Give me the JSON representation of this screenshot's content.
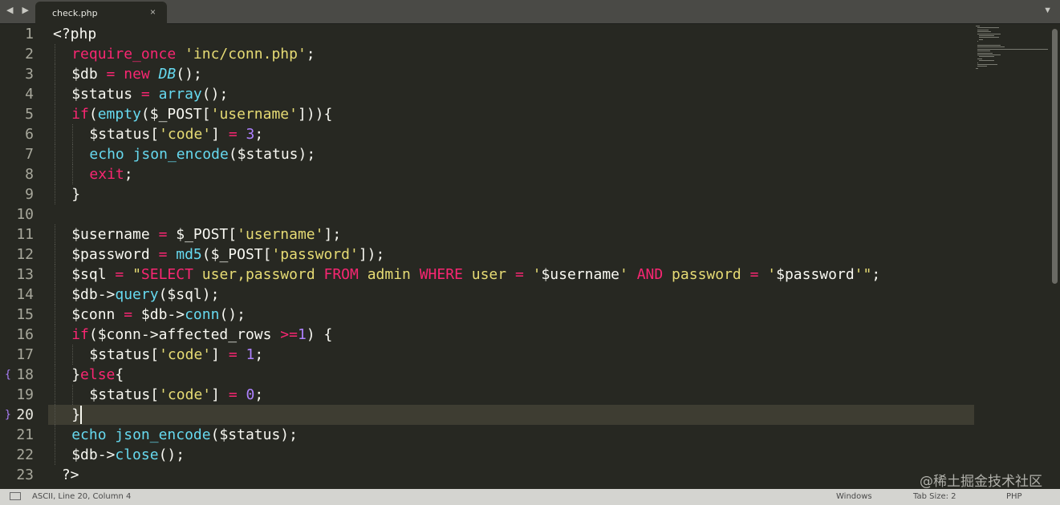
{
  "tab": {
    "filename": "check.php",
    "close_glyph": "×",
    "nav_glyph": "◀ ▶",
    "dropdown_glyph": "▼"
  },
  "editor": {
    "active_line": 20,
    "lines": [
      {
        "n": "1",
        "indent": 0,
        "tokens": [
          [
            "pl",
            "<?php"
          ]
        ]
      },
      {
        "n": "2",
        "indent": 1,
        "tokens": [
          [
            "kw",
            "require_once"
          ],
          [
            "pl",
            " "
          ],
          [
            "str",
            "'inc/conn.php'"
          ],
          [
            "pl",
            ";"
          ]
        ]
      },
      {
        "n": "3",
        "indent": 1,
        "tokens": [
          [
            "pl",
            "$db "
          ],
          [
            "kw",
            "="
          ],
          [
            "pl",
            " "
          ],
          [
            "kw",
            "new"
          ],
          [
            "pl",
            " "
          ],
          [
            "cls",
            "DB"
          ],
          [
            "pl",
            "();"
          ]
        ]
      },
      {
        "n": "4",
        "indent": 1,
        "tokens": [
          [
            "pl",
            "$status "
          ],
          [
            "kw",
            "="
          ],
          [
            "pl",
            " "
          ],
          [
            "fn",
            "array"
          ],
          [
            "pl",
            "();"
          ]
        ]
      },
      {
        "n": "5",
        "indent": 1,
        "tokens": [
          [
            "kw",
            "if"
          ],
          [
            "pl",
            "("
          ],
          [
            "fn",
            "empty"
          ],
          [
            "pl",
            "($_POST["
          ],
          [
            "str",
            "'username'"
          ],
          [
            "pl",
            "])){"
          ]
        ]
      },
      {
        "n": "6",
        "indent": 2,
        "tokens": [
          [
            "pl",
            "$status["
          ],
          [
            "str",
            "'code'"
          ],
          [
            "pl",
            "] "
          ],
          [
            "kw",
            "="
          ],
          [
            "pl",
            " "
          ],
          [
            "num",
            "3"
          ],
          [
            "pl",
            ";"
          ]
        ]
      },
      {
        "n": "7",
        "indent": 2,
        "tokens": [
          [
            "fn",
            "echo"
          ],
          [
            "pl",
            " "
          ],
          [
            "fn",
            "json_encode"
          ],
          [
            "pl",
            "($status);"
          ]
        ]
      },
      {
        "n": "8",
        "indent": 2,
        "tokens": [
          [
            "kw",
            "exit"
          ],
          [
            "pl",
            ";"
          ]
        ]
      },
      {
        "n": "9",
        "indent": 1,
        "tokens": [
          [
            "pl",
            "}"
          ]
        ]
      },
      {
        "n": "10",
        "indent": 0,
        "tokens": []
      },
      {
        "n": "11",
        "indent": 1,
        "tokens": [
          [
            "pl",
            "$username "
          ],
          [
            "kw",
            "="
          ],
          [
            "pl",
            " $_POST["
          ],
          [
            "str",
            "'username'"
          ],
          [
            "pl",
            "];"
          ]
        ]
      },
      {
        "n": "12",
        "indent": 1,
        "tokens": [
          [
            "pl",
            "$password "
          ],
          [
            "kw",
            "="
          ],
          [
            "pl",
            " "
          ],
          [
            "fn",
            "md5"
          ],
          [
            "pl",
            "($_POST["
          ],
          [
            "str",
            "'password'"
          ],
          [
            "pl",
            "]);"
          ]
        ]
      },
      {
        "n": "13",
        "indent": 1,
        "tokens": [
          [
            "pl",
            "$sql "
          ],
          [
            "kw",
            "="
          ],
          [
            "pl",
            " "
          ],
          [
            "str",
            "\""
          ],
          [
            "kw",
            "SELECT"
          ],
          [
            "str",
            " user,password "
          ],
          [
            "kw",
            "FROM"
          ],
          [
            "str",
            " admin "
          ],
          [
            "kw",
            "WHERE"
          ],
          [
            "str",
            " user "
          ],
          [
            "kw",
            "="
          ],
          [
            "str",
            " '"
          ],
          [
            "pl",
            "$username"
          ],
          [
            "str",
            "' "
          ],
          [
            "kw",
            "AND"
          ],
          [
            "str",
            " password "
          ],
          [
            "kw",
            "="
          ],
          [
            "str",
            " '"
          ],
          [
            "pl",
            "$password"
          ],
          [
            "str",
            "'\""
          ],
          [
            "pl",
            ";"
          ]
        ]
      },
      {
        "n": "14",
        "indent": 1,
        "tokens": [
          [
            "pl",
            "$db->"
          ],
          [
            "fn",
            "query"
          ],
          [
            "pl",
            "($sql);"
          ]
        ]
      },
      {
        "n": "15",
        "indent": 1,
        "tokens": [
          [
            "pl",
            "$conn "
          ],
          [
            "kw",
            "="
          ],
          [
            "pl",
            " $db->"
          ],
          [
            "fn",
            "conn"
          ],
          [
            "pl",
            "();"
          ]
        ]
      },
      {
        "n": "16",
        "indent": 1,
        "tokens": [
          [
            "kw",
            "if"
          ],
          [
            "pl",
            "($conn->affected_rows "
          ],
          [
            "kw",
            ">="
          ],
          [
            "num",
            "1"
          ],
          [
            "pl",
            ") {"
          ]
        ]
      },
      {
        "n": "17",
        "indent": 2,
        "tokens": [
          [
            "pl",
            "$status["
          ],
          [
            "str",
            "'code'"
          ],
          [
            "pl",
            "] "
          ],
          [
            "kw",
            "="
          ],
          [
            "pl",
            " "
          ],
          [
            "num",
            "1"
          ],
          [
            "pl",
            ";"
          ]
        ]
      },
      {
        "n": "18",
        "indent": 1,
        "fold": "{",
        "tokens": [
          [
            "pl",
            "}"
          ],
          [
            "kw",
            "else"
          ],
          [
            "pl",
            "{"
          ]
        ]
      },
      {
        "n": "19",
        "indent": 2,
        "tokens": [
          [
            "pl",
            "$status["
          ],
          [
            "str",
            "'code'"
          ],
          [
            "pl",
            "] "
          ],
          [
            "kw",
            "="
          ],
          [
            "pl",
            " "
          ],
          [
            "num",
            "0"
          ],
          [
            "pl",
            ";"
          ]
        ]
      },
      {
        "n": "20",
        "indent": 1,
        "fold": "}",
        "tokens": [
          [
            "pl",
            "}"
          ]
        ]
      },
      {
        "n": "21",
        "indent": 1,
        "tokens": [
          [
            "fn",
            "echo"
          ],
          [
            "pl",
            " "
          ],
          [
            "fn",
            "json_encode"
          ],
          [
            "pl",
            "($status);"
          ]
        ]
      },
      {
        "n": "22",
        "indent": 1,
        "tokens": [
          [
            "pl",
            "$db->"
          ],
          [
            "fn",
            "close"
          ],
          [
            "pl",
            "();"
          ]
        ]
      },
      {
        "n": "23",
        "indent": 0,
        "tokens": [
          [
            "pl",
            " ?>"
          ]
        ]
      }
    ]
  },
  "statusbar": {
    "position": "ASCII, Line 20, Column 4",
    "line_endings": "Windows",
    "tab_size": "Tab Size: 2",
    "syntax": "PHP"
  },
  "watermark": "@稀土掘金技术社区",
  "colors": {
    "background": "#272822",
    "keyword": "#f92672",
    "string": "#e6db74",
    "number": "#ae81ff",
    "function": "#66d9ef",
    "text": "#f8f8f2"
  }
}
